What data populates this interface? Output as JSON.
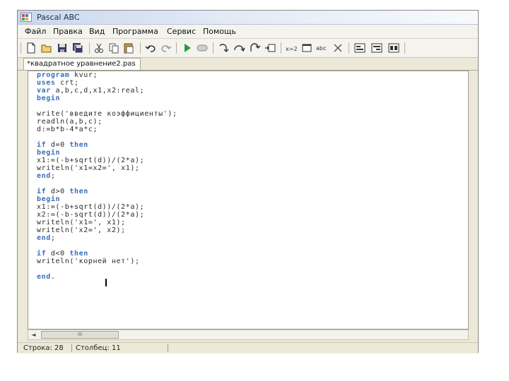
{
  "window": {
    "title": "Pascal ABC"
  },
  "menu": [
    {
      "label": "Файл"
    },
    {
      "label": "Правка"
    },
    {
      "label": "Вид"
    },
    {
      "label": "Программа"
    },
    {
      "label": "Сервис"
    },
    {
      "label": "Помощь"
    }
  ],
  "toolbar": {
    "icons": [
      "new-file-icon",
      "open-folder-icon",
      "save-icon",
      "save-all-icon",
      "cut-icon",
      "copy-icon",
      "paste-icon",
      "undo-icon",
      "redo-icon",
      "run-icon",
      "stop-icon",
      "step-into-icon",
      "step-over-icon",
      "step-out-icon",
      "run-to-cursor-icon",
      "watch-icon",
      "window-icon",
      "breakpoint-icon",
      "clear-icon",
      "compile-icon",
      "build-icon",
      "options-icon"
    ]
  },
  "tab": {
    "label": "*квадратное уравнение2.pas"
  },
  "editor": {
    "lines": [
      "program kvur;",
      "uses crt;",
      "var a,b,c,d,x1,x2:real;",
      "begin",
      "",
      "write('введите коэффициенты');",
      "readln(a,b,c);",
      "d:=b*b-4*a*c;",
      "",
      "if d=0 then",
      "begin",
      "x1:=(-b+sqrt(d))/(2*a);",
      "writeln('x1=x2=', x1);",
      "end;",
      "",
      "if d>0 then",
      "begin",
      "x1:=(-b+sqrt(d))/(2*a);",
      "x2:=(-b-sqrt(d))/(2*a);",
      "writeln('x1=', x1);",
      "writeln('x2=', x2);",
      "end;",
      "",
      "if d<0 then",
      "writeln('корней нет');",
      "",
      "end."
    ]
  },
  "scrollbar": {
    "thumb_grip": "III"
  },
  "status": {
    "line": "Строка: 28",
    "column": "Столбец: 11"
  }
}
